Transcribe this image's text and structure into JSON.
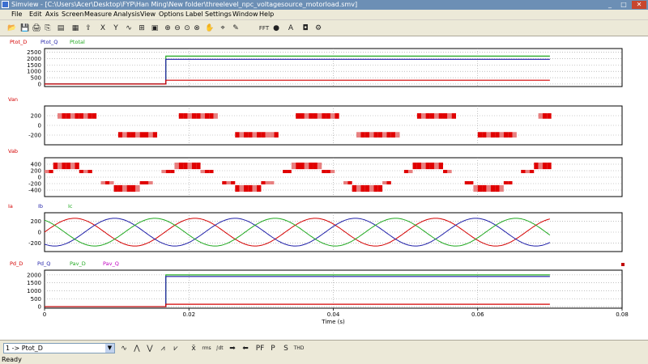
{
  "window": {
    "title": "Simview - [C:\\Users\\Acer\\Desktop\\FYP\\Han Ming\\New folder\\threelevel_npc_voltagesource_motorload.smv]",
    "controls": [
      "_",
      "□",
      "✕"
    ]
  },
  "menu": [
    "File",
    "Edit",
    "Axis",
    "Screen",
    "Measure",
    "Analysis",
    "View",
    "Options",
    "Label",
    "Settings",
    "Window",
    "Help"
  ],
  "toolbar": {
    "buttons": [
      {
        "name": "open-icon",
        "glyph": "📂"
      },
      {
        "name": "save-icon",
        "glyph": "💾"
      },
      {
        "name": "print-icon",
        "glyph": "🖨"
      },
      {
        "name": "copy-icon",
        "glyph": "⎘"
      },
      {
        "name": "data-icon",
        "glyph": "▤"
      },
      {
        "name": "graph-icon",
        "glyph": "▦"
      },
      {
        "name": "export-icon",
        "glyph": "⇪"
      },
      {
        "name": "x-axis-button",
        "glyph": "X"
      },
      {
        "name": "y-axis-button",
        "glyph": "Y"
      },
      {
        "name": "wave-icon",
        "glyph": "∿"
      },
      {
        "name": "measure-icon",
        "glyph": "⊞"
      },
      {
        "name": "screen-icon",
        "glyph": "▣"
      },
      {
        "name": "zoom-in-icon",
        "glyph": "⊕"
      },
      {
        "name": "zoom-out-icon",
        "glyph": "⊖"
      },
      {
        "name": "zoom-fit-icon",
        "glyph": "⊙"
      },
      {
        "name": "zoom-x-icon",
        "glyph": "⊗"
      },
      {
        "name": "pan-icon",
        "glyph": "✋"
      },
      {
        "name": "cursor-icon",
        "glyph": "⌖"
      },
      {
        "name": "marker-icon",
        "glyph": "✎"
      },
      {
        "name": "fft-button",
        "glyph": "FFT"
      },
      {
        "name": "record-icon",
        "glyph": "●"
      },
      {
        "name": "text-button",
        "glyph": "A"
      },
      {
        "name": "label-icon",
        "glyph": "◘"
      },
      {
        "name": "settings-icon",
        "glyph": "⚙"
      }
    ]
  },
  "plots": [
    {
      "id": "ptot",
      "legend": [
        {
          "label": "Ptot_D",
          "color": "#d40000"
        },
        {
          "label": "Ptot_Q",
          "color": "#1f1fa8"
        },
        {
          "label": "Ptotal",
          "color": "#1fa81f"
        }
      ],
      "y_ticks": [
        "2500",
        "2000",
        "1500",
        "1000",
        "500",
        "0"
      ]
    },
    {
      "id": "van",
      "legend": [
        {
          "label": "Van",
          "color": "#d40000"
        }
      ],
      "y_ticks": [
        "200",
        "0",
        "-200"
      ]
    },
    {
      "id": "vab",
      "legend": [
        {
          "label": "Vab",
          "color": "#d40000"
        }
      ],
      "y_ticks": [
        "400",
        "200",
        "0",
        "-200",
        "-400"
      ]
    },
    {
      "id": "currents",
      "legend": [
        {
          "label": "Ia",
          "color": "#d40000"
        },
        {
          "label": "Ib",
          "color": "#1f1fa8"
        },
        {
          "label": "Ic",
          "color": "#1fa81f"
        }
      ],
      "y_ticks": [
        "200",
        "0",
        "-200"
      ]
    },
    {
      "id": "pd",
      "legend": [
        {
          "label": "Pd_D",
          "color": "#d40000"
        },
        {
          "label": "Pd_Q",
          "color": "#1f1fa8"
        },
        {
          "label": "Pav_D",
          "color": "#1fa81f"
        },
        {
          "label": "Pav_Q",
          "color": "#c000c0"
        }
      ],
      "y_ticks": [
        "2000",
        "1500",
        "1000",
        "500",
        "0"
      ]
    }
  ],
  "x_axis": {
    "ticks": [
      "0",
      "0.02",
      "0.04",
      "0.06",
      "0.08"
    ],
    "label": "Time (s)"
  },
  "chart_data": [
    {
      "type": "line",
      "series": [
        {
          "name": "Ptotal",
          "x": [
            0,
            0.0168,
            0.0168,
            0.07
          ],
          "values": [
            0,
            0,
            2200,
            2200
          ]
        },
        {
          "name": "Ptot_Q",
          "x": [
            0,
            0.0168,
            0.0168,
            0.07
          ],
          "values": [
            0,
            0,
            1950,
            1950
          ]
        },
        {
          "name": "Ptot_D",
          "x": [
            0,
            0.0168,
            0.0168,
            0.07
          ],
          "values": [
            0,
            0,
            300,
            300
          ]
        }
      ],
      "ylim": [
        -200,
        2800
      ],
      "xlim": [
        0,
        0.08
      ]
    },
    {
      "type": "line",
      "series": [
        {
          "name": "Van",
          "x": [
            0,
            0.07
          ],
          "values": [
            -250,
            250
          ]
        }
      ],
      "ylim": [
        -400,
        400
      ],
      "xlim": [
        0,
        0.08
      ]
    },
    {
      "type": "line",
      "series": [
        {
          "name": "Vab",
          "x": [
            0,
            0.07
          ],
          "values": [
            -450,
            450
          ]
        }
      ],
      "ylim": [
        -600,
        600
      ],
      "xlim": [
        0,
        0.08
      ]
    },
    {
      "type": "line",
      "series": [
        {
          "name": "Ia",
          "amplitude": 250,
          "frequency_hz": 60,
          "phase_deg": 0
        },
        {
          "name": "Ib",
          "amplitude": 250,
          "frequency_hz": 60,
          "phase_deg": -120
        },
        {
          "name": "Ic",
          "amplitude": 250,
          "frequency_hz": 60,
          "phase_deg": 120
        }
      ],
      "ylim": [
        -350,
        350
      ],
      "xlim": [
        0,
        0.07
      ]
    },
    {
      "type": "line",
      "series": [
        {
          "name": "Pav_D",
          "x": [
            0,
            0.0168,
            0.0168,
            0.07
          ],
          "values": [
            0,
            0,
            2000,
            2000
          ]
        },
        {
          "name": "Pd_Q",
          "x": [
            0,
            0.0168,
            0.0168,
            0.07
          ],
          "values": [
            0,
            0,
            1900,
            1900
          ]
        },
        {
          "name": "Pd_D",
          "x": [
            0,
            0.0168,
            0.0168,
            0.07
          ],
          "values": [
            0,
            0,
            150,
            150
          ]
        }
      ],
      "ylim": [
        -100,
        2300
      ],
      "xlim": [
        0,
        0.08
      ]
    }
  ],
  "bottom_toolbar": {
    "selected_variable": "1 -> Ptot_D",
    "buttons": [
      {
        "name": "wave-view-icon",
        "glyph": "∿"
      },
      {
        "name": "peak-max-icon",
        "glyph": "⋀"
      },
      {
        "name": "peak-min-icon",
        "glyph": "⋁"
      },
      {
        "name": "slope-up-icon",
        "glyph": "⩘"
      },
      {
        "name": "slope-down-icon",
        "glyph": "⩗"
      },
      {
        "name": "mean-button",
        "glyph": "x̄"
      },
      {
        "name": "rms-button",
        "glyph": "rms"
      },
      {
        "name": "integral-button",
        "glyph": "∫dt"
      },
      {
        "name": "arrow-right-icon",
        "glyph": "➡"
      },
      {
        "name": "arrow-left-icon",
        "glyph": "⬅"
      },
      {
        "name": "pf-button",
        "glyph": "PF"
      },
      {
        "name": "p-button",
        "glyph": "P"
      },
      {
        "name": "s-button",
        "glyph": "S"
      },
      {
        "name": "thd-button",
        "glyph": "THD"
      }
    ]
  },
  "status": "Ready"
}
